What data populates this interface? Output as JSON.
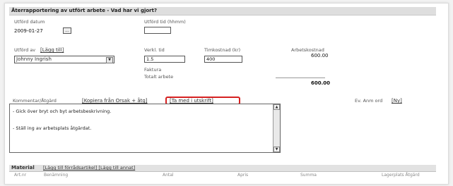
{
  "header": {
    "title": "Återrapportering av utfört arbete - Vad har vi gjort?"
  },
  "form": {
    "utford_datum": {
      "label": "Utförd datum",
      "value": "2009-01-27",
      "btn": "..."
    },
    "utford_tid": {
      "label": "Utförd tid (hhmm)",
      "value": ""
    },
    "utford_av": {
      "label": "Utförd av",
      "link": "[Lägg till]",
      "value": "Johnny Ingrish"
    },
    "verkl_tid": {
      "label": "Verkl. tid",
      "value": "1.5"
    },
    "timkostnad": {
      "label": "Timkostnad (kr)",
      "value": "400"
    },
    "arbetskostnad": {
      "label": "Arbetskostnad",
      "value": "600.00"
    },
    "faktura": {
      "label": "Faktura"
    },
    "totalt": {
      "label": "Totalt arbete",
      "value": "600.00"
    }
  },
  "comment": {
    "label": "Kommentar/Åtgärd",
    "link1": "[Kopiera från Orsak + åtg]",
    "link2": "[Ta med i utskrift]",
    "lines": [
      "- Gick över bryt och byt arbetsbeskrivning.",
      "- Ställ ing av arbetsplats åtgärdat."
    ],
    "extra_label": "Ev. Anm ord",
    "extra_link": "[Ny]"
  },
  "material": {
    "title": "Material",
    "link": "[Lägg till förrådsartikel] [Lägg till annat]",
    "columns": [
      "Art.nr",
      "Benämning",
      "Antal",
      "Apris",
      "Summa",
      "Lagerplats Åtgärd"
    ]
  },
  "colors": {
    "highlight": "#d62020"
  }
}
